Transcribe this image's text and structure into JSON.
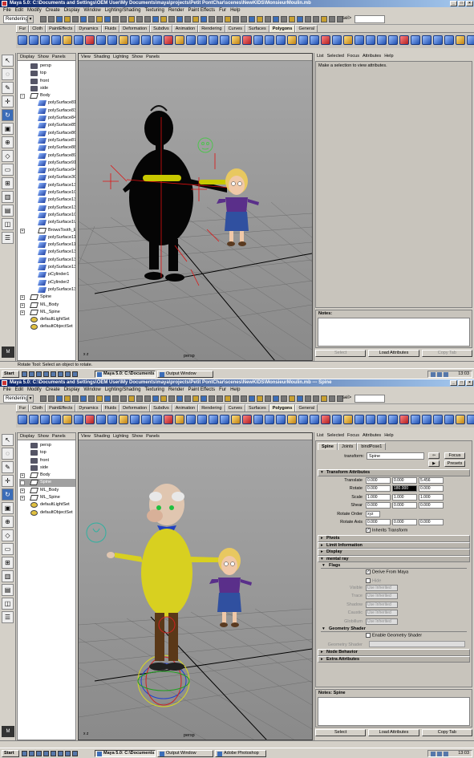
{
  "app": {
    "title": "Maya 5.0: C:\\Documents and Settings\\OEM User\\My Documents\\maya\\projects\\Petit PontChar\\scenes\\NewKIDS\\MonsieurMoulin.mb",
    "title2": "Maya 5.0: C:\\Documents and Settings\\OEM User\\My Documents\\maya\\projects\\Petit PontChar\\scenes\\NewKIDS\\MonsieurMoulin.mb  ---  Spine",
    "menu": [
      "File",
      "Edit",
      "Modify",
      "Create",
      "Display",
      "Window",
      "Lighting/Shading",
      "Texturing",
      "Render",
      "Paint Effects",
      "Fur",
      "Help"
    ],
    "mode": "Rendering",
    "sel_label": "sel>",
    "shelf_tabs": [
      "Fur",
      "Cloth",
      "PaintEffects",
      "Dynamics",
      "Fluids",
      "Deformation",
      "Subdivs",
      "Animation",
      "Rendering",
      "Curves",
      "Surfaces",
      "Polygons",
      "General"
    ],
    "active_shelf": "Polygons"
  },
  "panel_menu": [
    "Display",
    "Show",
    "Panels"
  ],
  "viewport_menu": [
    "View",
    "Shading",
    "Lighting",
    "Show",
    "Panels"
  ],
  "viewport_label": "persp",
  "axis_label": "x z",
  "ae_menu": [
    "List",
    "Selected",
    "Focus",
    "Attributes",
    "Help"
  ],
  "screen1": {
    "outliner": [
      {
        "label": "persp",
        "icon": "cam",
        "child": false,
        "exp": ""
      },
      {
        "label": "top",
        "icon": "cam",
        "child": false,
        "exp": ""
      },
      {
        "label": "front",
        "icon": "cam",
        "child": false,
        "exp": ""
      },
      {
        "label": "side",
        "icon": "cam",
        "child": false,
        "exp": ""
      },
      {
        "label": "Body",
        "icon": "grp",
        "child": false,
        "exp": "−"
      },
      {
        "label": "polySurface81",
        "icon": "mesh",
        "child": true,
        "exp": ""
      },
      {
        "label": "polySurface83",
        "icon": "mesh",
        "child": true,
        "exp": ""
      },
      {
        "label": "polySurface84",
        "icon": "mesh",
        "child": true,
        "exp": ""
      },
      {
        "label": "polySurface85",
        "icon": "mesh",
        "child": true,
        "exp": ""
      },
      {
        "label": "polySurface86",
        "icon": "mesh",
        "child": true,
        "exp": ""
      },
      {
        "label": "polySurface87",
        "icon": "mesh",
        "child": true,
        "exp": ""
      },
      {
        "label": "polySurface88",
        "icon": "mesh",
        "child": true,
        "exp": ""
      },
      {
        "label": "polySurface89",
        "icon": "mesh",
        "child": true,
        "exp": ""
      },
      {
        "label": "polySurface91",
        "icon": "mesh",
        "child": true,
        "exp": ""
      },
      {
        "label": "polySurface94",
        "icon": "mesh",
        "child": true,
        "exp": ""
      },
      {
        "label": "polySurface3C",
        "icon": "mesh",
        "child": true,
        "exp": ""
      },
      {
        "label": "polySurface13",
        "icon": "mesh",
        "child": true,
        "exp": ""
      },
      {
        "label": "polySurface10",
        "icon": "mesh",
        "child": true,
        "exp": ""
      },
      {
        "label": "polySurface13",
        "icon": "mesh",
        "child": true,
        "exp": ""
      },
      {
        "label": "polySurface13",
        "icon": "mesh",
        "child": true,
        "exp": ""
      },
      {
        "label": "polySurface10",
        "icon": "mesh",
        "child": true,
        "exp": ""
      },
      {
        "label": "polySurface1U",
        "icon": "mesh",
        "child": true,
        "exp": ""
      },
      {
        "label": "BrowsTooth_E",
        "icon": "grp",
        "child": true,
        "exp": "+"
      },
      {
        "label": "polySurface11",
        "icon": "mesh",
        "child": true,
        "exp": ""
      },
      {
        "label": "polySurface11",
        "icon": "mesh",
        "child": true,
        "exp": ""
      },
      {
        "label": "polySurface13",
        "icon": "mesh",
        "child": true,
        "exp": ""
      },
      {
        "label": "polySurface13",
        "icon": "mesh",
        "child": true,
        "exp": ""
      },
      {
        "label": "polySurface13",
        "icon": "mesh",
        "child": true,
        "exp": ""
      },
      {
        "label": "pCylinder1",
        "icon": "mesh",
        "child": true,
        "exp": ""
      },
      {
        "label": "pCylinder2",
        "icon": "mesh",
        "child": true,
        "exp": ""
      },
      {
        "label": "polySurface13",
        "icon": "mesh",
        "child": true,
        "exp": ""
      },
      {
        "label": "Spine",
        "icon": "grp",
        "child": false,
        "exp": "+"
      },
      {
        "label": "ML_Body",
        "icon": "grp",
        "child": false,
        "exp": "+"
      },
      {
        "label": "ML_Spine",
        "icon": "grp",
        "child": false,
        "exp": "+"
      },
      {
        "label": "defaultLightSet",
        "icon": "set",
        "child": false,
        "exp": ""
      },
      {
        "label": "defaultObjectSet",
        "icon": "set",
        "child": false,
        "exp": ""
      }
    ],
    "ae_message": "Make a selection to view attributes.",
    "notes_title": "Notes:",
    "buttons": [
      "Select",
      "Load Attributes",
      "Copy Tab"
    ],
    "help": "Rotate Tool: Select an object to rotate.",
    "tasks": [
      "Maya 5.0: C:\\Documents...",
      "Output Window"
    ],
    "clock": "13:03"
  },
  "screen2": {
    "outliner": [
      {
        "label": "persp",
        "icon": "cam",
        "exp": ""
      },
      {
        "label": "top",
        "icon": "cam",
        "exp": ""
      },
      {
        "label": "front",
        "icon": "cam",
        "exp": ""
      },
      {
        "label": "side",
        "icon": "cam",
        "exp": ""
      },
      {
        "label": "Body",
        "icon": "grp",
        "exp": "+"
      },
      {
        "label": "Spine",
        "icon": "grp",
        "exp": "+",
        "hl": true
      },
      {
        "label": "ML_Body",
        "icon": "grp",
        "exp": "+"
      },
      {
        "label": "ML_Spine",
        "icon": "grp",
        "exp": "+"
      },
      {
        "label": "defaultLightSet",
        "icon": "set",
        "exp": ""
      },
      {
        "label": "defaultObjectSet",
        "icon": "set",
        "exp": ""
      }
    ],
    "ae_tabs": [
      "Spine",
      "Joints",
      "bindPose1"
    ],
    "transform_label": "transform:",
    "transform_value": "Spine",
    "focus": "Focus",
    "presets": "Presets",
    "sections": {
      "transform": "Transform Attributes",
      "pivots": "Pivots",
      "limit": "Limit Information",
      "display": "Display",
      "mental": "mental ray",
      "flags": "Flags",
      "geometry": "Geometry Shader",
      "node": "Node Behavior",
      "extra": "Extra Attributes"
    },
    "attrs": [
      {
        "label": "Translate",
        "v": [
          "0.000",
          "0.000",
          "5.456"
        ]
      },
      {
        "label": "Rotate",
        "v": [
          "0.000",
          "180.000",
          "0.000"
        ],
        "hl": 1
      },
      {
        "label": "Scale",
        "v": [
          "1.000",
          "1.000",
          "1.000"
        ]
      },
      {
        "label": "Shear",
        "v": [
          "0.000",
          "0.000",
          "0.000"
        ]
      }
    ],
    "rotate_order_label": "Rotate Order",
    "rotate_order": "xyz",
    "rotate_axis_label": "Rotate Axis",
    "rotate_axis": [
      "0.000",
      "0.000",
      "0.000"
    ],
    "inherits": "Inherits Transform",
    "derive": "Derive From Maya",
    "hide": "Hide",
    "flag_rows": [
      {
        "label": "Visible",
        "v": "Use Inherited"
      },
      {
        "label": "Trace",
        "v": "Use Inherited"
      },
      {
        "label": "Shadow",
        "v": "Use Inherited"
      },
      {
        "label": "Caustic",
        "v": "Use Inherited"
      },
      {
        "label": "Globillum",
        "v": "Use Inherited"
      }
    ],
    "enable_geo": "Enable Geometry Shader",
    "geo_label": "Geometry Shader",
    "notes_title": "Notes: Spine",
    "buttons": [
      "Select",
      "Load Attributes",
      "Copy Tab"
    ],
    "help": "",
    "tasks": [
      "Maya 5.0: C:\\Documents...",
      "Output Window",
      "Adobe Photoshop"
    ],
    "clock": "13:03"
  }
}
